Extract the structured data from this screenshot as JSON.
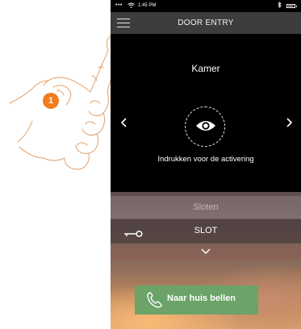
{
  "status_bar": {
    "signal": "•••",
    "time": "1:45 PM",
    "bluetooth_icon": "bluetooth-icon",
    "battery_icon": "battery-icon"
  },
  "nav": {
    "menu_icon": "hamburger-menu-icon",
    "title": "DOOR ENTRY"
  },
  "camera": {
    "title": "Kamer",
    "caption": "Indrukken voor de activering",
    "prev_icon": "chevron-left-icon",
    "next_icon": "chevron-right-icon",
    "activate_icon": "eye-icon"
  },
  "locks": {
    "header": "Sloten",
    "item_label": "SLOT",
    "item_icon": "key-icon",
    "expand_icon": "chevron-down-icon"
  },
  "call_button": {
    "label": "Naar huis bellen",
    "icon": "phone-icon",
    "color": "#6ba368"
  },
  "step_badge": {
    "number": "1",
    "color": "#f07d1d"
  }
}
